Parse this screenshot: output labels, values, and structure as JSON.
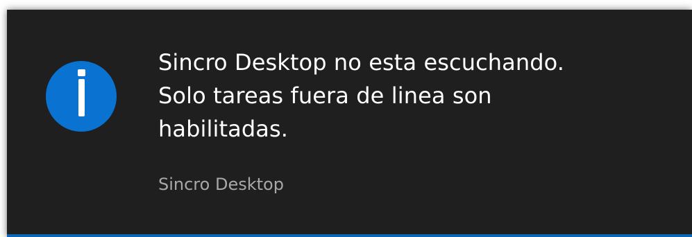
{
  "notification": {
    "message_lines": [
      "Sincro Desktop no esta escuchando.",
      "Solo tareas fuera de linea son",
      "habilitadas."
    ],
    "app_name": "Sincro Desktop",
    "icon": "info-icon",
    "colors": {
      "background": "#1f1f1f",
      "icon_circle": "#0a73d1",
      "accent": "#0a66b7",
      "message_text": "#ffffff",
      "app_text": "#a8a8a8"
    }
  }
}
